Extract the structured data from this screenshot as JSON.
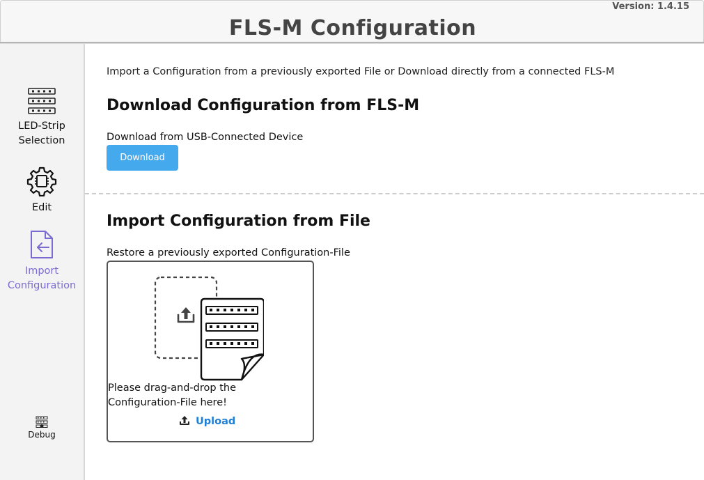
{
  "header": {
    "version": "Version: 1.4.15",
    "title": "FLS-M Configuration"
  },
  "sidebar": {
    "items": [
      {
        "label": "LED-Strip\nSelection",
        "icon": "led-strip-icon",
        "active": false
      },
      {
        "label": "Edit",
        "icon": "gear-chip-icon",
        "active": false
      },
      {
        "label": "Import\nConfiguration",
        "icon": "file-import-icon",
        "active": true
      }
    ],
    "debug": {
      "label": "Debug",
      "icon": "debug-icon"
    },
    "accent_color": "#7a6bd1"
  },
  "main": {
    "intro": "Import a Configuration from a previously exported File or Download directly from a connected FLS-M",
    "download": {
      "title": "Download Configuration from FLS-M",
      "description": "Download from USB-Connected Device",
      "button_label": "Download",
      "button_color": "#45a9ee"
    },
    "import": {
      "title": "Import Configuration from File",
      "description": "Restore a previously exported Configuration-File",
      "dropzone_text": "Please drag-and-drop the Configuration-File here!",
      "upload_label": "Upload",
      "upload_color": "#1e7fd8"
    }
  }
}
